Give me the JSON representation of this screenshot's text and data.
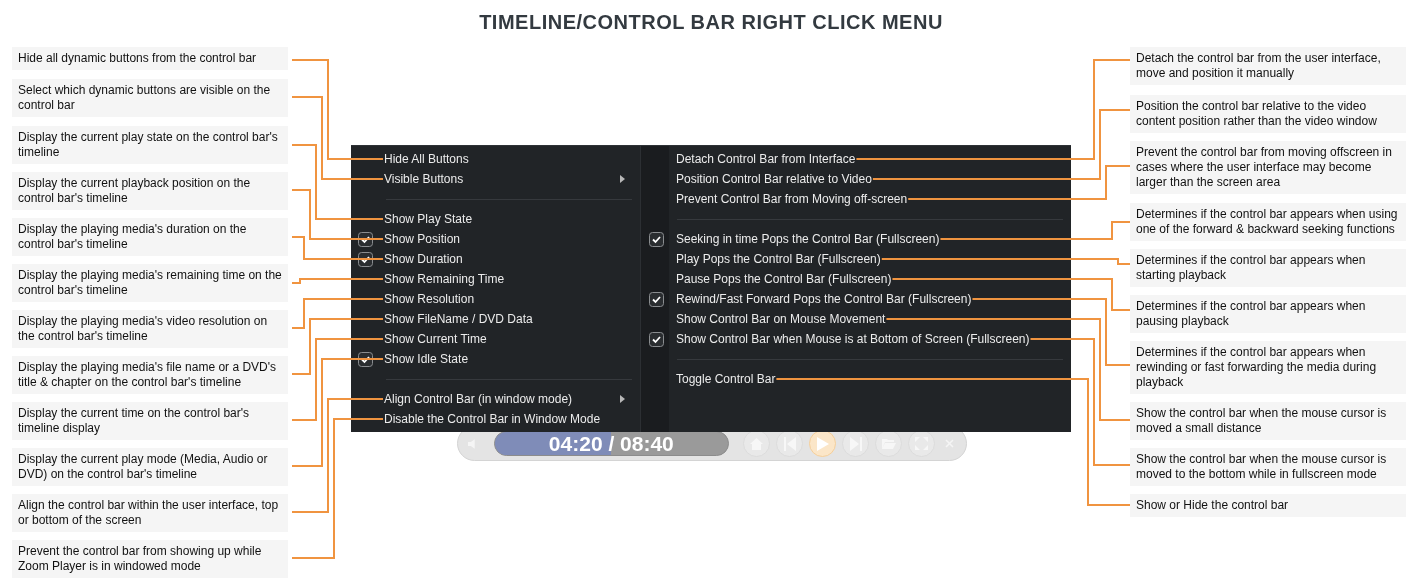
{
  "title": "TIMELINE/CONTROL BAR RIGHT CLICK MENU",
  "menu": {
    "left_items": [
      {
        "kind": "item",
        "label": "Hide All Buttons",
        "checked": false,
        "submenu": false
      },
      {
        "kind": "item",
        "label": "Visible Buttons",
        "checked": false,
        "submenu": true
      },
      {
        "kind": "separator"
      },
      {
        "kind": "item",
        "label": "Show Play State",
        "checked": false,
        "submenu": false
      },
      {
        "kind": "item",
        "label": "Show Position",
        "checked": true,
        "submenu": false
      },
      {
        "kind": "item",
        "label": "Show Duration",
        "checked": true,
        "submenu": false
      },
      {
        "kind": "item",
        "label": "Show Remaining Time",
        "checked": false,
        "submenu": false
      },
      {
        "kind": "item",
        "label": "Show Resolution",
        "checked": false,
        "submenu": false
      },
      {
        "kind": "item",
        "label": "Show FileName / DVD Data",
        "checked": false,
        "submenu": false
      },
      {
        "kind": "item",
        "label": "Show Current Time",
        "checked": false,
        "submenu": false
      },
      {
        "kind": "item",
        "label": "Show Idle State",
        "checked": true,
        "submenu": false
      },
      {
        "kind": "separator"
      },
      {
        "kind": "item",
        "label": "Align Control Bar (in window mode)",
        "checked": false,
        "submenu": true
      },
      {
        "kind": "item",
        "label": "Disable the Control Bar in Window Mode",
        "checked": false,
        "submenu": false
      }
    ],
    "right_items": [
      {
        "kind": "item",
        "label": "Detach Control Bar from Interface",
        "checked": false
      },
      {
        "kind": "item",
        "label": "Position Control Bar relative to Video",
        "checked": false
      },
      {
        "kind": "item",
        "label": "Prevent Control Bar from Moving off-screen",
        "checked": false
      },
      {
        "kind": "separator"
      },
      {
        "kind": "item",
        "label": "Seeking in time Pops the Control Bar (Fullscreen)",
        "checked": true
      },
      {
        "kind": "item",
        "label": "Play Pops the Control Bar (Fullscreen)",
        "checked": false
      },
      {
        "kind": "item",
        "label": "Pause Pops the Control Bar (Fullscreen)",
        "checked": false
      },
      {
        "kind": "item",
        "label": "Rewind/Fast Forward Pops the Control Bar (Fullscreen)",
        "checked": true
      },
      {
        "kind": "item",
        "label": "Show Control Bar on Mouse Movement",
        "checked": false
      },
      {
        "kind": "item",
        "label": "Show Control Bar when Mouse is at Bottom of Screen (Fullscreen)",
        "checked": true
      },
      {
        "kind": "separator"
      },
      {
        "kind": "item",
        "label": "Toggle Control Bar",
        "checked": false
      }
    ]
  },
  "left_notes": [
    "Hide all dynamic buttons from the control bar",
    "Select which dynamic buttons are visible on the control bar",
    "Display the current play state on the control bar's timeline",
    "Display the current playback position on the control bar's timeline",
    "Display the playing media's duration on the control bar's timeline",
    "Display the playing media's remaining time on the control bar's timeline",
    "Display the playing media's video resolution on the control bar's timeline",
    "Display the playing media's file name or a DVD's title & chapter on the control bar's timeline",
    "Display the current time on the control bar's timeline display",
    "Display the current play mode (Media, Audio or DVD) on the control bar's timeline",
    "Align the control bar within the user interface, top or bottom of the screen",
    "Prevent the control bar from showing up while Zoom Player is in windowed mode"
  ],
  "right_notes": [
    "Detach the control bar from the user interface, move and position it manually",
    "Position the control bar relative to the video content position rather than the video window",
    "Prevent the control bar from moving offscreen in cases where the user interface may become larger than the screen area",
    "Determines if the control bar appears when using one of the forward & backward seeking functions",
    "Determines if the control bar appears when starting playback",
    "Determines if the control bar appears when pausing playback",
    "Determines if the control bar appears when rewinding or fast forwarding the media during playback",
    "Show the control bar when the mouse cursor is moved a small distance",
    "Show the control bar when the mouse cursor is moved to the bottom while in fullscreen mode",
    "Show or Hide the control bar"
  ],
  "control_bar": {
    "time": "04:20 / 08:40",
    "level": 0.5
  }
}
